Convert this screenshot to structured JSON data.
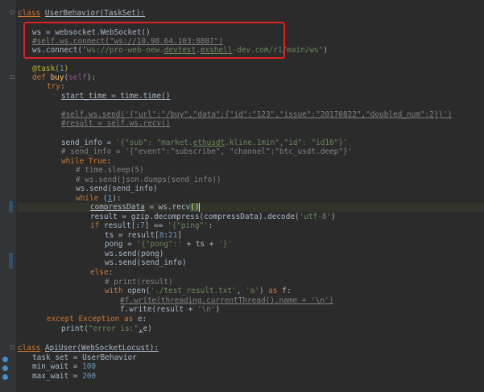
{
  "code": {
    "l1": {
      "kw": "class",
      "name": "UserBehavior",
      "rest": "(TaskSet):"
    },
    "l2": "ws = websocket.WebSocket()",
    "l3": "#self.ws.connect(\"ws://10.98.64.103:8807\")",
    "l4a": "ws.connect(",
    "l4b": "\"ws://pro-web-new.",
    "l4c": "devtest",
    "l4d": ".",
    "l4e": "exshell",
    "l4f": "-dev.com/r1/main/ws\"",
    "l4g": ")",
    "l5a": "@task(",
    "l5b": "1",
    "l5c": ")",
    "l6a": "def ",
    "l6b": "buy",
    "l6c": "(",
    "l6d": "self",
    "l6e": "):",
    "l7a": "try",
    "l7b": ":",
    "l8": "start_time = time.time()",
    "l9": "#self.ws.send('{\"url\":\"/buy\",\"data\":{\"id\":\"123\",\"issue\":\"20170822\",\"doubled_num\":2}}')",
    "l10": "#result = self.ws.recv()",
    "l11a": "send_info = ",
    "l11b": "'{\"sub\": \"market.",
    "l11c": "ethusdt",
    "l11d": ".kline.1min\",\"id\": \"id10\"}'",
    "l12": "# send_info = '{\"event\":\"subscribe\", \"channel\":\"btc_usdt.deep\"}'",
    "l13a": "while ",
    "l13b": "True",
    "l13c": ":",
    "l14": "# time.sleep(5)",
    "l15": "# ws.send(json.dumps(send_info))",
    "l16": "ws.send(send_info)",
    "l17a": "while ",
    "l17b": "(",
    "l17c": "1",
    "l17d": "):",
    "l18a": "compressData",
    "l18b": " = ws.recv",
    "l18c": "()",
    "l19a": "result = gzip.decompress(compressData).decode(",
    "l19b": "'utf-8'",
    "l19c": ")",
    "l20a": "if ",
    "l20b": "result[:",
    "l20c": "7",
    "l20d": "] == ",
    "l20e": "'{\"ping\"'",
    "l20f": ":",
    "l21a": "ts = result[",
    "l21b": "8",
    "l21c": ":",
    "l21d": "21",
    "l21e": "]",
    "l22a": "pong = ",
    "l22b": "'{\"pong\":'",
    "l22c": " + ts + ",
    "l22d": "'}'",
    "l23": "ws.send(pong)",
    "l24": "ws.send(send_info)",
    "l25a": "else",
    "l25b": ":",
    "l26": "# print(result)",
    "l27a": "with ",
    "l27b": "open(",
    "l27c": "'./test_result.txt'",
    "l27d": ", ",
    "l27e": "'a'",
    "l27f": ") ",
    "l27g": "as ",
    "l27h": "f:",
    "l28": "#f.write(threading.currentThread().name + '\\n')",
    "l29a": "f.write(result + ",
    "l29b": "'\\n'",
    "l29c": ")",
    "l30a": "except ",
    "l30b": "Exception ",
    "l30c": "as ",
    "l30d": "e:",
    "l31a": "print(",
    "l31b": "\"error is:\"",
    "l31c": ",",
    "l31d": "e",
    "l31e": ")",
    "l32": {
      "kw": "class",
      "name": "ApiUser",
      "rest": "(WebSocketLocust):"
    },
    "l33": "task_set = UserBehavior",
    "l34a": "min_wait = ",
    "l34b": "100",
    "l35a": "max_wait = ",
    "l35b": "200"
  },
  "colors": {
    "background": "#2b2b2b",
    "keyword": "#cc7832",
    "string": "#6a8759",
    "number": "#6897bb",
    "comment": "#808080",
    "highlight_box": "#e02020"
  }
}
